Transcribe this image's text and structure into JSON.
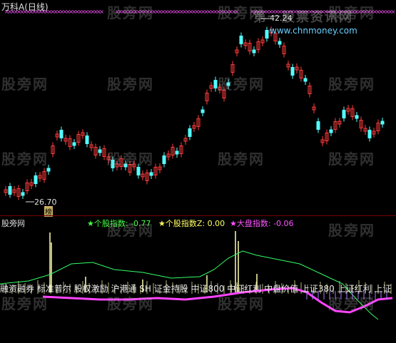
{
  "header": {
    "title": "万科A(日线)",
    "high_label": "42.24",
    "low_label": "26.70",
    "low_marker": "榜"
  },
  "legend": {
    "item1": "个股指数: -0.77",
    "item2": "个股指数Z: 0.00",
    "item3": "大盘指数: -0.06",
    "sub_title": "股旁网"
  },
  "bottom_ticker": "融资融券 标准普尔 股权激励 沪港通 SH 证金持股 中证800 中证红利 中盘价值 上证380 上证红利 上证",
  "watermarks": {
    "text": "股旁网",
    "site_top": "第一股票资讯网",
    "site_url": "www.chnmoney.com"
  },
  "colors": {
    "up": "#ff3b3b",
    "down": "#54ffff",
    "line_green": "#33ff66",
    "line_magenta": "#ff44ff",
    "spike": "#ffffaa",
    "legend1": "#44ff44",
    "legend2": "#ffff66",
    "legend3": "#ff55ff"
  }
}
